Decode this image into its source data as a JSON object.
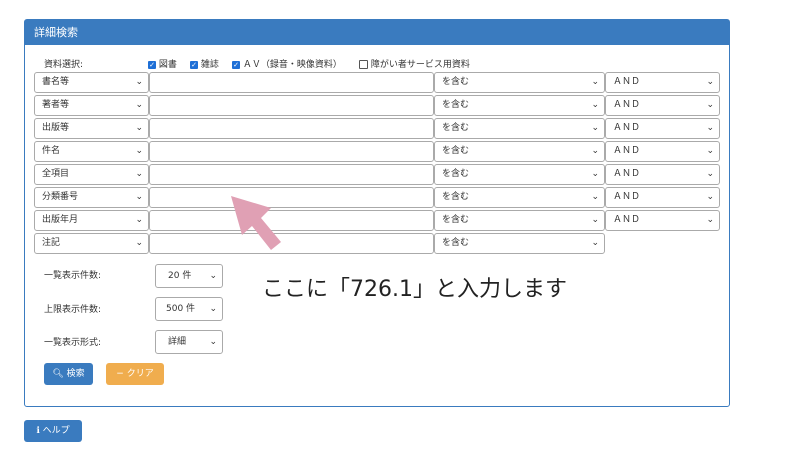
{
  "panel": {
    "title": "詳細検索"
  },
  "material": {
    "label": "資料選択:",
    "options": [
      {
        "label": "図書",
        "checked": true
      },
      {
        "label": "雑誌",
        "checked": true
      },
      {
        "label": "ＡＶ（録音・映像資料）",
        "checked": true
      },
      {
        "label": "障がい者サービス用資料",
        "checked": false
      }
    ]
  },
  "rows": [
    {
      "field": "書名等",
      "match": "を含む",
      "op": "ＡＮＤ"
    },
    {
      "field": "著者等",
      "match": "を含む",
      "op": "ＡＮＤ"
    },
    {
      "field": "出版等",
      "match": "を含む",
      "op": "ＡＮＤ"
    },
    {
      "field": "件名",
      "match": "を含む",
      "op": "ＡＮＤ"
    },
    {
      "field": "全項目",
      "match": "を含む",
      "op": "ＡＮＤ"
    },
    {
      "field": "分類番号",
      "match": "を含む",
      "op": "ＡＮＤ"
    },
    {
      "field": "出版年月",
      "match": "を含む",
      "op": "ＡＮＤ"
    },
    {
      "field": "注記",
      "match": "を含む",
      "op": ""
    }
  ],
  "settings": {
    "list_count": {
      "label": "一覧表示件数:",
      "value": "20 件"
    },
    "max_count": {
      "label": "上限表示件数:",
      "value": "500 件"
    },
    "list_format": {
      "label": "一覧表示形式:",
      "value": "詳細"
    }
  },
  "buttons": {
    "search": "検索",
    "clear": "クリア",
    "help": "ヘルプ"
  },
  "annotation": {
    "text": "ここに「726.1」と入力します",
    "arrow_color": "#e0a0b4"
  },
  "colors": {
    "primary": "#3a7bbf",
    "warning": "#f0ad4e",
    "checkbox": "#1e6fd6"
  }
}
